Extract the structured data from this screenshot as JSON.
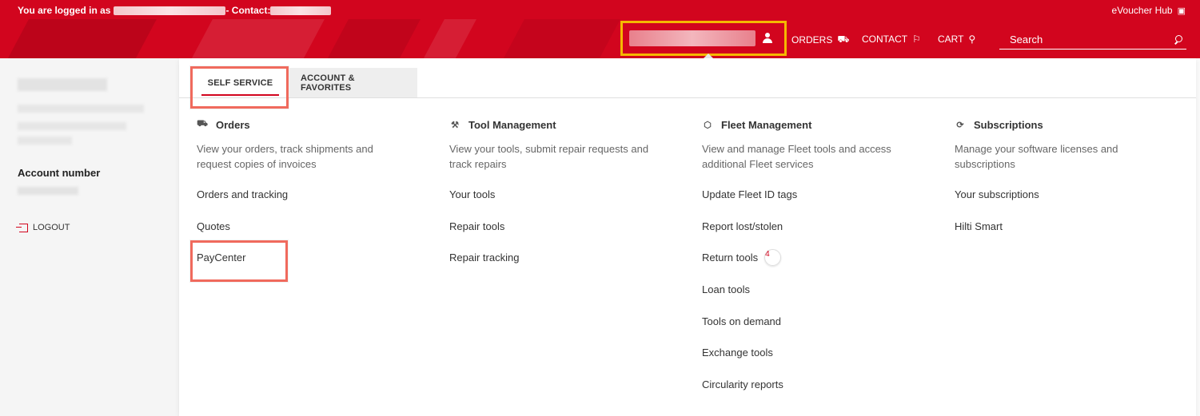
{
  "topbar": {
    "logged_in_prefix": "You are logged in as",
    "contact_prefix": "- Contact:",
    "evoucher_label": "eVoucher Hub"
  },
  "header": {
    "nav": {
      "orders_label": "ORDERS",
      "contact_label": "CONTACT",
      "cart_label": "CART"
    },
    "search": {
      "placeholder": "Search"
    }
  },
  "sidebar": {
    "account_label": "Account number",
    "logout_label": "LOGOUT"
  },
  "tabs": [
    {
      "label": "SELF SERVICE",
      "active": true
    },
    {
      "label": "ACCOUNT & FAVORITES",
      "active": false
    }
  ],
  "columns": [
    {
      "title": "Orders",
      "icon": "truck-icon",
      "description": "View your orders, track shipments and request copies of invoices",
      "items": [
        "Orders and tracking",
        "Quotes",
        "PayCenter"
      ]
    },
    {
      "title": "Tool Management",
      "icon": "drill-icon",
      "description": "View your tools, submit repair requests and track repairs",
      "items": [
        "Your tools",
        "Repair tools",
        "Repair tracking"
      ]
    },
    {
      "title": "Fleet Management",
      "icon": "hexagon-icon",
      "description": "View and manage Fleet tools and access additional Fleet services",
      "items": [
        "Update Fleet ID tags",
        "Report lost/stolen",
        "Return tools",
        "Loan tools",
        "Tools on demand",
        "Exchange tools",
        "Circularity reports"
      ],
      "return_badge": "4"
    },
    {
      "title": "Subscriptions",
      "icon": "refresh-icon",
      "description": "Manage your software licenses and subscriptions",
      "items": [
        "Your subscriptions",
        "Hilti Smart"
      ]
    }
  ],
  "colors": {
    "brand_red": "#d2051e",
    "highlight_yellow": "#f5b800",
    "highlight_coral": "#f06a5d"
  }
}
